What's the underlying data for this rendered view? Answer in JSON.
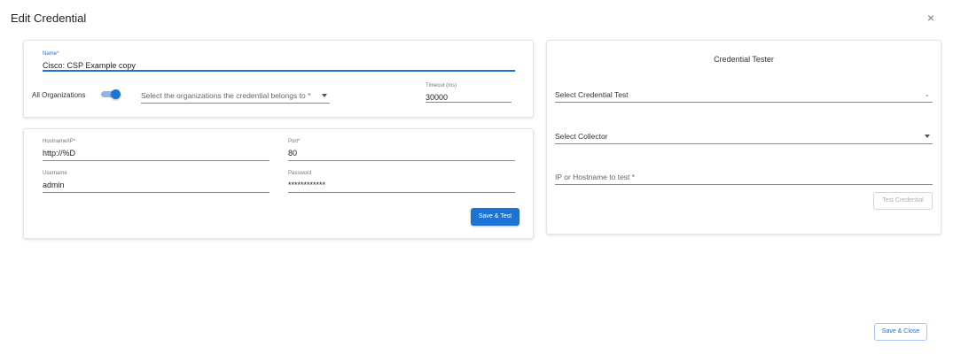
{
  "dialog": {
    "title": "Edit Credential",
    "close_glyph": "×"
  },
  "form": {
    "name": {
      "label": "Name",
      "required": "*",
      "value": "Cisco: CSP Example copy"
    },
    "all_orgs": {
      "label": "All Organizations",
      "enabled": true
    },
    "orgs_select": {
      "placeholder": "Select the organizations the credential belongs to",
      "required": "*"
    },
    "timeout": {
      "label": "Timeout (ms)",
      "value": "30000"
    },
    "hostname": {
      "label": "Hostname/IP",
      "required": "*",
      "value": "http://%D"
    },
    "port": {
      "label": "Port",
      "required": "*",
      "value": "80"
    },
    "username": {
      "label": "Username",
      "value": "admin"
    },
    "password": {
      "label": "Password",
      "value": "************"
    },
    "save_test_label": "Save & Test"
  },
  "tester": {
    "title": "Credential Tester",
    "credential_test_select": "Select Credential Test",
    "collector_select": "Select Collector",
    "ip_field": {
      "label": "IP or Hostname to test",
      "required": "*"
    },
    "test_button_label": "Test Credential"
  },
  "footer": {
    "save_close_label": "Save & Close"
  },
  "colors": {
    "accent": "#1b73d3",
    "border": "#e4e4e4"
  }
}
